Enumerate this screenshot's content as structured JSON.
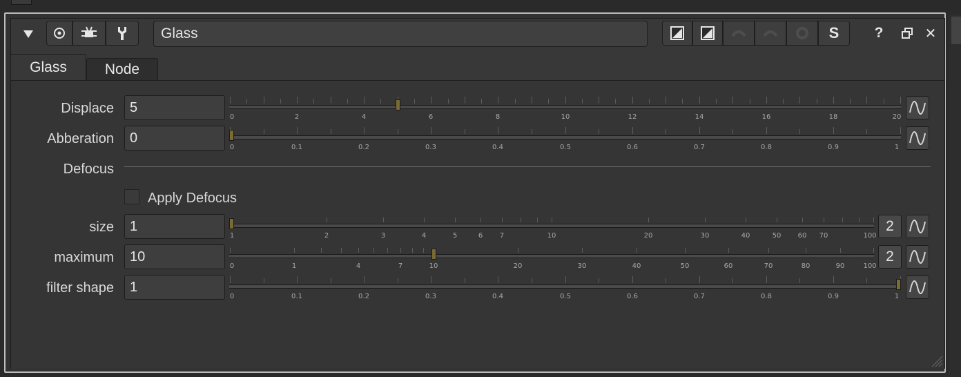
{
  "header": {
    "collapse_icon": "triangle-down-icon",
    "buttons": [
      "viewer-input-icon",
      "bug-icon",
      "wrench-icon"
    ],
    "node_name": "Glass",
    "tools": [
      "reset-icon",
      "reset-icon",
      "undo-icon",
      "redo-icon",
      "revert-icon"
    ],
    "s_label": "S",
    "help_label": "?",
    "float_icon": "float-window-icon",
    "close_label": "✕"
  },
  "tabs": [
    {
      "label": "Glass"
    },
    {
      "label": "Node"
    }
  ],
  "knobs": {
    "displace": {
      "label": "Displace",
      "value": "5",
      "slider_value": 5,
      "ticks": [
        "0",
        "2",
        "4",
        "6",
        "8",
        "10",
        "12",
        "14",
        "16",
        "18",
        "20"
      ]
    },
    "abberation": {
      "label": "Abberation",
      "value": "0",
      "slider_value": 0,
      "ticks": [
        "0",
        "0.1",
        "0.2",
        "0.3",
        "0.4",
        "0.5",
        "0.6",
        "0.7",
        "0.8",
        "0.9",
        "1"
      ]
    },
    "defocus": {
      "label": "Defocus"
    },
    "apply_defocus": {
      "label": "Apply Defocus",
      "checked": false
    },
    "size": {
      "label": "size",
      "value": "1",
      "slider_value": 1,
      "ticks": [
        "1",
        "2",
        "3",
        "4",
        "5",
        "6",
        "7",
        "10",
        "20",
        "30",
        "40",
        "50",
        "60",
        "70",
        "100"
      ],
      "views": "2"
    },
    "maximum": {
      "label": "maximum",
      "value": "10",
      "slider_value": 10,
      "ticks": [
        "0",
        "1",
        "4",
        "7",
        "10",
        "20",
        "30",
        "40",
        "50",
        "60",
        "70",
        "80",
        "90",
        "100"
      ],
      "views": "2"
    },
    "filter_shape": {
      "label": "filter shape",
      "value": "1",
      "slider_value": 1,
      "ticks": [
        "0",
        "0.1",
        "0.2",
        "0.3",
        "0.4",
        "0.5",
        "0.6",
        "0.7",
        "0.8",
        "0.9",
        "1"
      ]
    }
  },
  "colors": {
    "handle": "#7a6a34",
    "panel": "#383838",
    "field": "#3e3e3e"
  }
}
